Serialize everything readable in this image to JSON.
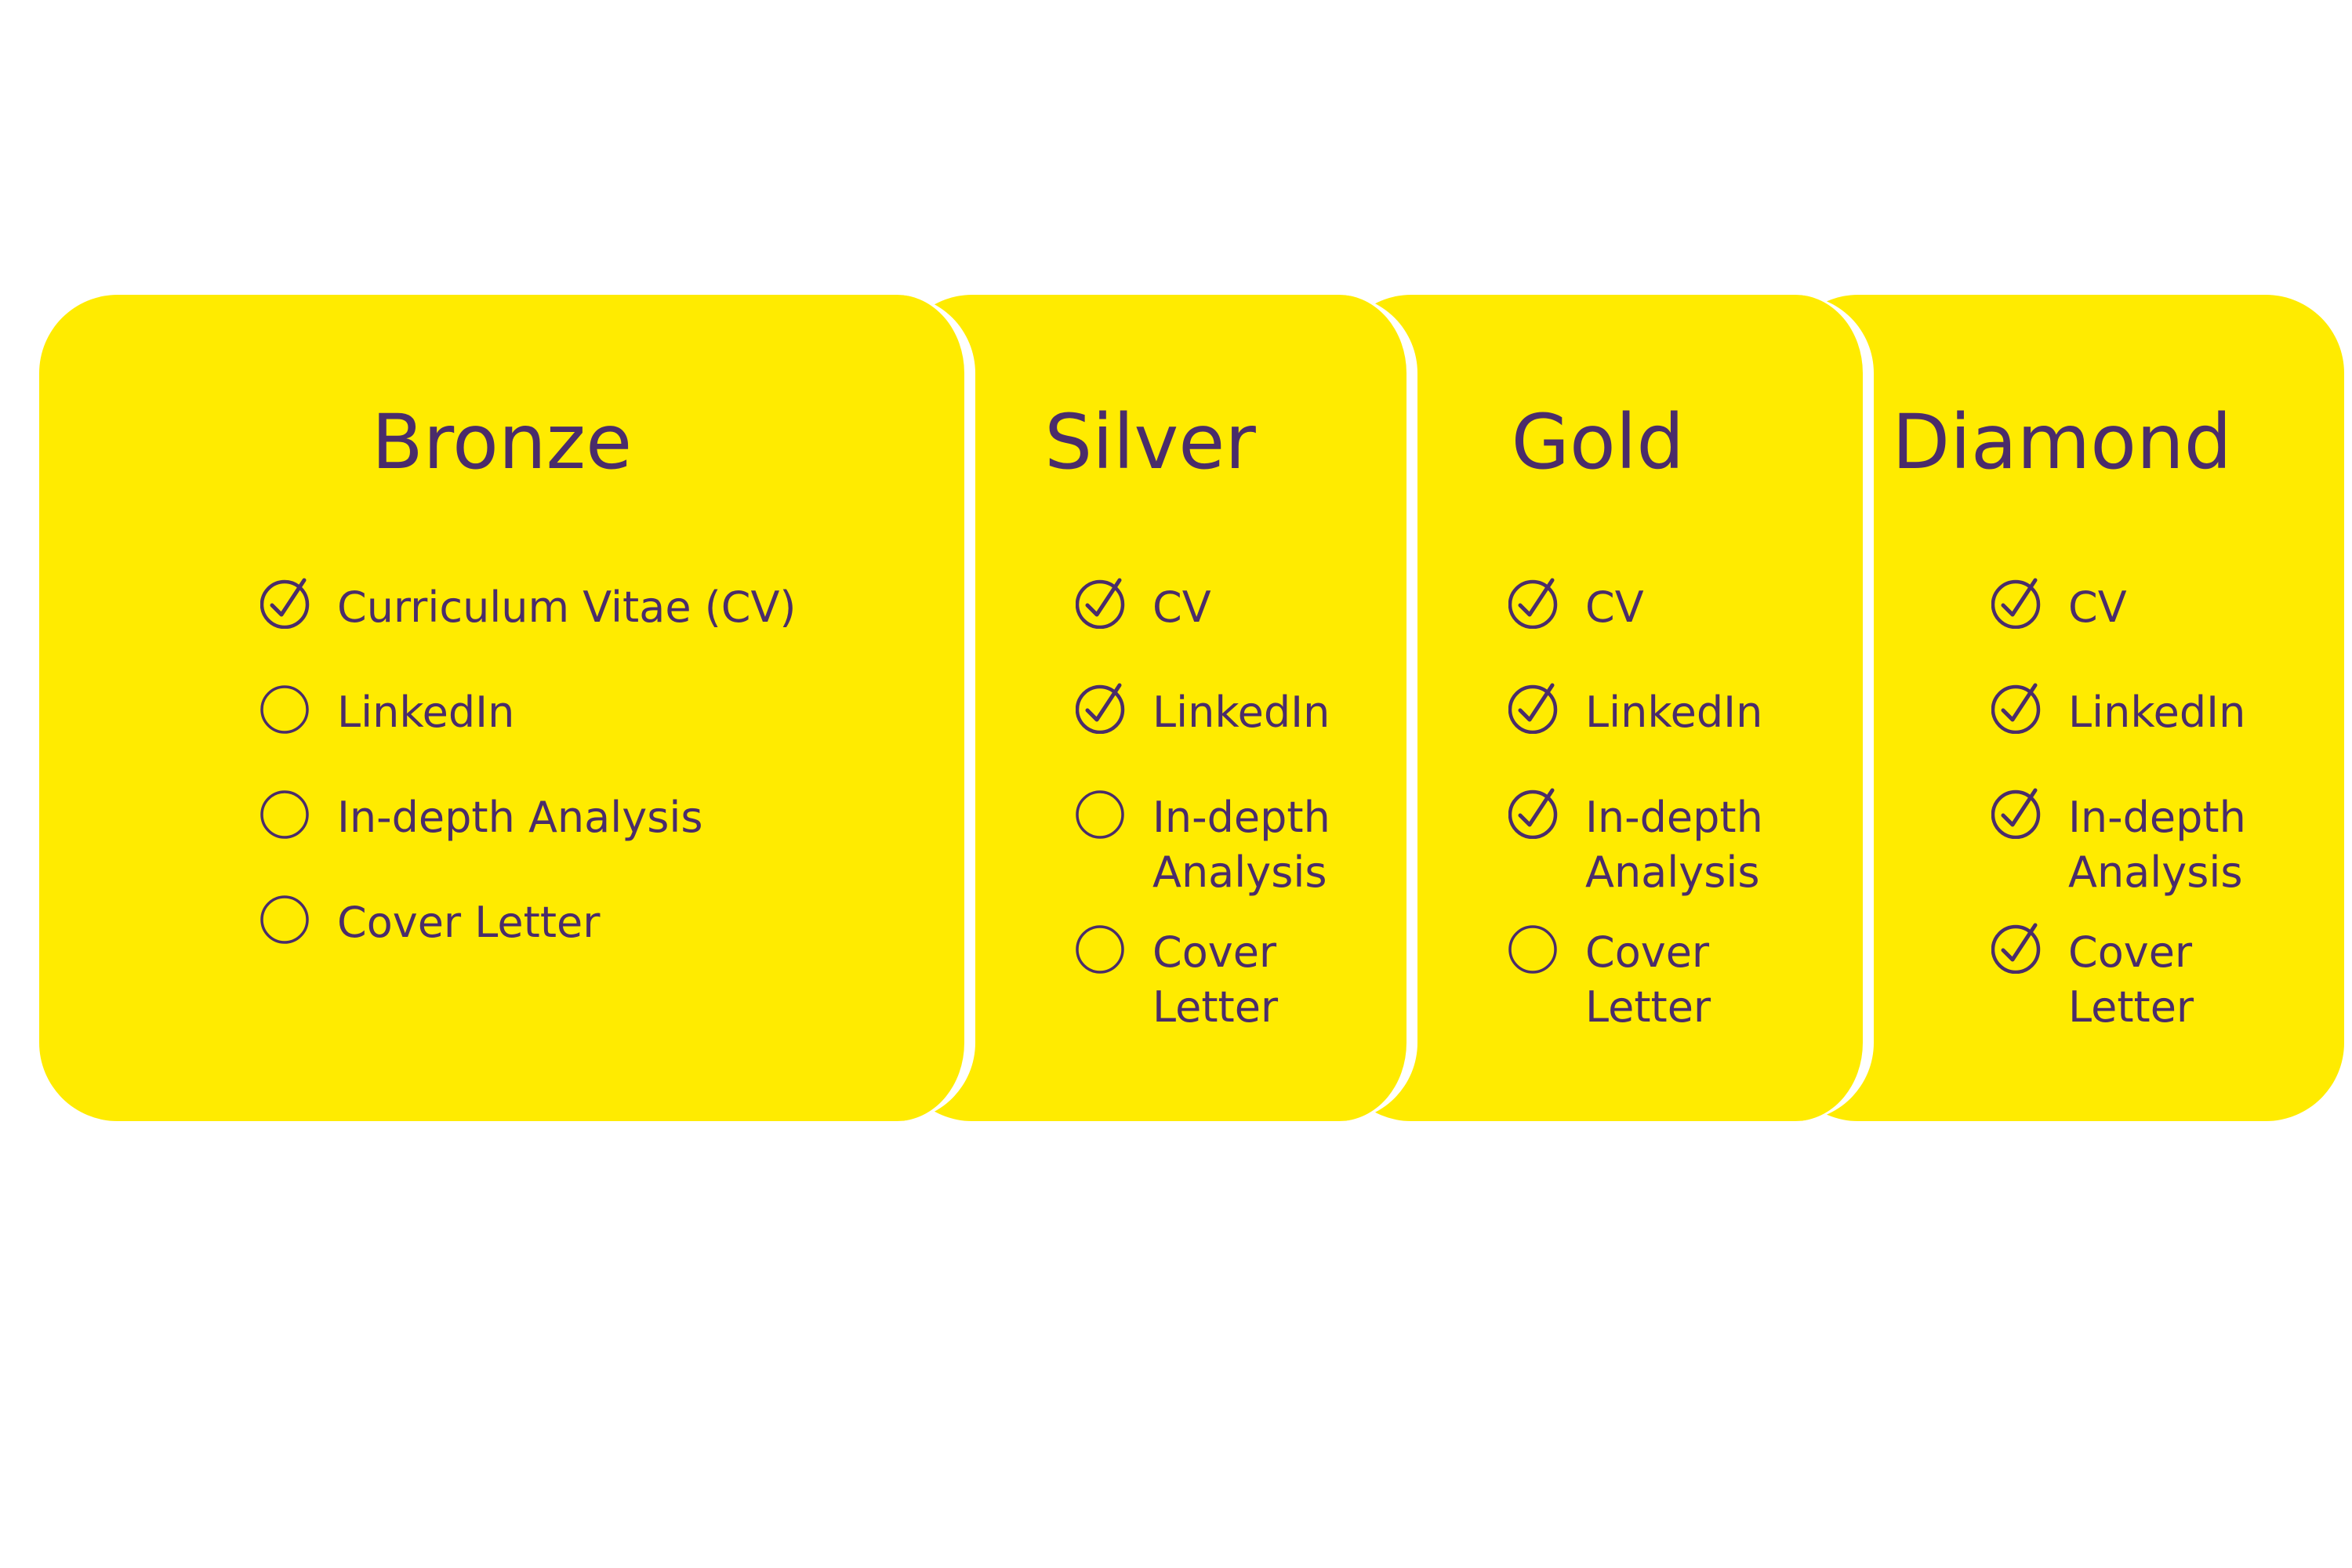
{
  "colors": {
    "card_bg": "#FFEB00",
    "text": "#4A2C6A",
    "divider": "#FFFFFF"
  },
  "icons": {
    "included": "check-circle-icon",
    "excluded": "empty-circle-icon"
  },
  "tiers": [
    {
      "name": "Bronze",
      "features": [
        {
          "label": "Curriculum Vitae (CV)",
          "included": true
        },
        {
          "label": "LinkedIn",
          "included": false
        },
        {
          "label": "In-depth Analysis",
          "included": false
        },
        {
          "label": "Cover Letter",
          "included": false
        }
      ]
    },
    {
      "name": "Silver",
      "features": [
        {
          "label": "CV",
          "included": true
        },
        {
          "label": "LinkedIn",
          "included": true
        },
        {
          "label": "In-depth Analysis",
          "included": false
        },
        {
          "label": "Cover Letter",
          "included": false
        }
      ]
    },
    {
      "name": "Gold",
      "features": [
        {
          "label": "CV",
          "included": true
        },
        {
          "label": "LinkedIn",
          "included": true
        },
        {
          "label": "In-depth Analysis",
          "included": true
        },
        {
          "label": "Cover Letter",
          "included": false
        }
      ]
    },
    {
      "name": "Diamond",
      "features": [
        {
          "label": "CV",
          "included": true
        },
        {
          "label": "LinkedIn",
          "included": true
        },
        {
          "label": "In-depth Analysis",
          "included": true
        },
        {
          "label": "Cover Letter",
          "included": true
        }
      ]
    }
  ]
}
